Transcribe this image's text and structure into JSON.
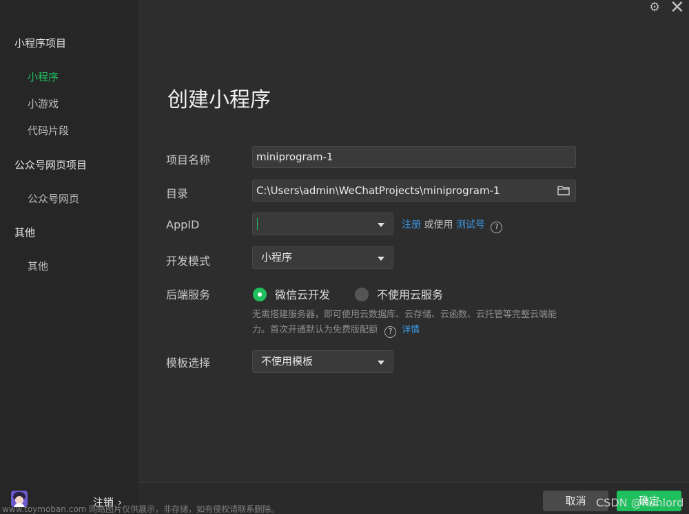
{
  "sidebar": {
    "sections": [
      {
        "title": "小程序项目",
        "items": [
          "小程序",
          "小游戏",
          "代码片段"
        ]
      },
      {
        "title": "公众号网页项目",
        "items": [
          "公众号网页"
        ]
      },
      {
        "title": "其他",
        "items": [
          "其他"
        ]
      }
    ],
    "active_item": "小程序",
    "logout_label": "注销",
    "logout_chevron": "›"
  },
  "window": {
    "settings_icon": "gear-icon",
    "close_icon": "close-icon",
    "gear_glyph": "⚙",
    "close_glyph": "✕"
  },
  "main": {
    "title": "创建小程序",
    "fields": {
      "project_name": {
        "label": "项目名称",
        "value": "miniprogram-1"
      },
      "directory": {
        "label": "目录",
        "value": "C:\\Users\\admin\\WeChatProjects\\miniprogram-1"
      },
      "appid": {
        "label": "AppID",
        "value": "",
        "register": "注册",
        "or_use": "或使用",
        "test_account": "测试号",
        "help": "?"
      },
      "dev_mode": {
        "label": "开发模式",
        "value": "小程序"
      },
      "backend": {
        "label": "后端服务",
        "options": [
          "微信云开发",
          "不使用云服务"
        ],
        "selected": "微信云开发",
        "desc_1": "无需搭建服务器，即可使用云数据库、云存储、云函数、云托管等完整云端能",
        "desc_2": "力。首次开通默认为免费版配额",
        "help": "?",
        "details_link": "详情"
      },
      "template": {
        "label": "模板选择",
        "value": "不使用模板"
      }
    }
  },
  "buttons": {
    "cancel": "取消",
    "confirm": "确定"
  },
  "overlay": {
    "watermark": "www.toymoban.com 网络图片仅供展示，非存储，如有侵权请联系删除。",
    "csdn": "CSDN @Kunlord"
  },
  "colors": {
    "accent": "#1fbf5e",
    "link": "#3a97e6",
    "background": "#2d2d2d",
    "sidebar": "#262626"
  }
}
